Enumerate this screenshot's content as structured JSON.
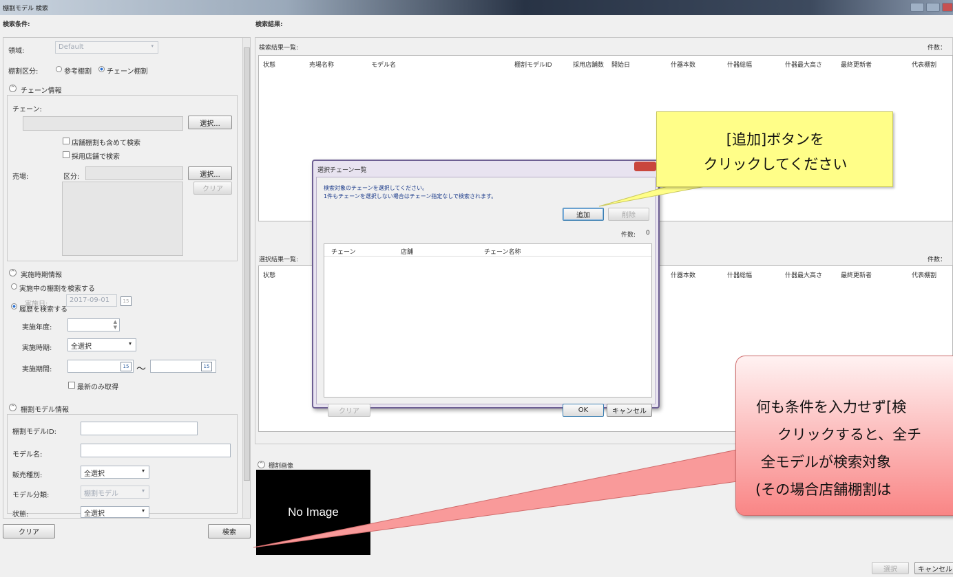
{
  "window": {
    "title": "棚割モデル 検索"
  },
  "left": {
    "header": "検索条件:",
    "region_label": "領域:",
    "region_value": "Default",
    "division_label": "棚割区分:",
    "division_opt1": "参考棚割",
    "division_opt2": "チェーン棚割",
    "chain_section": "チェーン情報",
    "chain_label": "チェーン:",
    "select_btn": "選択...",
    "chk_store": "店舗棚割も含めて検索",
    "chk_adopt": "採用店舗で検索",
    "sales_label": "売場:",
    "kubun_label": "区分:",
    "select_btn2": "選択...",
    "clear_btn": "クリア",
    "period_section": "実施時期情報",
    "radio_current": "実施中の棚割を検索する",
    "impl_date_label": "実施日:",
    "impl_date_value": "2017-09-01",
    "radio_history": "履歴を検索する",
    "impl_year_label": "実施年度:",
    "impl_period_label": "実施時期:",
    "impl_period_value": "全選択",
    "impl_range_label": "実施期間:",
    "range_sep": "～",
    "chk_latest": "最新のみ取得",
    "model_section": "棚割モデル情報",
    "model_id_label": "棚割モデルID:",
    "model_name_label": "モデル名:",
    "sales_type_label": "販売種別:",
    "sales_type_value": "全選択",
    "model_class_label": "モデル分類:",
    "model_class_value": "棚割モデル",
    "status_label": "状態:",
    "status_value": "全選択",
    "cal_icon": "15",
    "bottom_clear": "クリア",
    "bottom_search": "検索"
  },
  "right": {
    "header": "検索結果:",
    "list_title": "検索結果一覧:",
    "count_label": "件数：",
    "columns": [
      "状態",
      "売場名称",
      "モデル名",
      "棚割モデルID",
      "採用店舗数",
      "開始日",
      "什器本数",
      "什器総幅",
      "什器最大高さ",
      "最終更新者",
      "代表棚割"
    ],
    "sel_title": "選択結果一覧:",
    "sel_count_label": "件数：",
    "sel_columns": [
      "状態",
      "",
      "什器本数",
      "什器総幅",
      "什器最大高さ",
      "最終更新者",
      "代表棚割"
    ],
    "image_section": "棚割画像",
    "no_image": "No Image",
    "select_btn": "選択",
    "cancel_btn": "キャンセル"
  },
  "dialog": {
    "title": "選択チェーン一覧",
    "msg1": "検索対象のチェーンを選択してください。",
    "msg2": "1件もチェーンを選択しない場合はチェーン指定なしで検索されます。",
    "add_btn": "追加",
    "delete_btn": "削除",
    "count_label": "件数:",
    "count_value": "0",
    "columns": [
      "チェーン",
      "店舗",
      "チェーン名称"
    ],
    "clear_btn": "クリア",
    "ok_btn": "OK",
    "cancel_btn": "キャンセル"
  },
  "callout1": {
    "line1": "[追加]ボタンを",
    "line2": "クリックしてください"
  },
  "callout2": {
    "line1": "何も条件を入力せず[検",
    "line2": "クリックすると、全チ",
    "line3": "全モデルが検索対象",
    "line4": "(その場合店舗棚割は"
  }
}
